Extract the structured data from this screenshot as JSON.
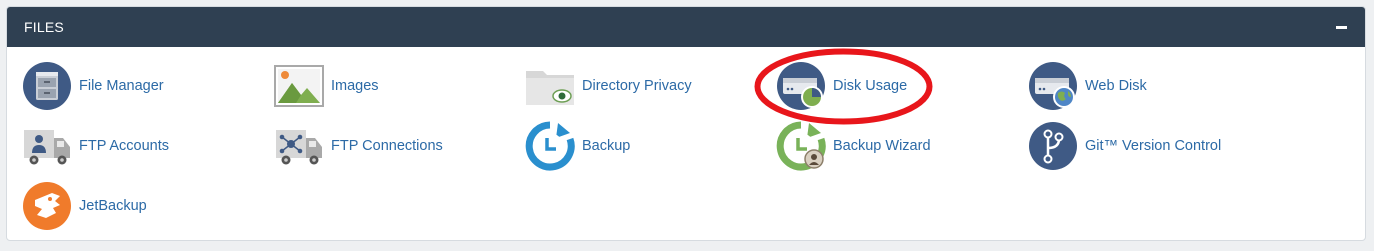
{
  "panel": {
    "title": "FILES",
    "collapse_icon": "minus-icon"
  },
  "items": [
    {
      "label": "File Manager",
      "icon": "file-cabinet-icon"
    },
    {
      "label": "Images",
      "icon": "image-landscape-icon"
    },
    {
      "label": "Directory Privacy",
      "icon": "folder-eye-icon"
    },
    {
      "label": "Disk Usage",
      "icon": "disk-pie-chart-icon"
    },
    {
      "label": "Web Disk",
      "icon": "disk-globe-icon"
    },
    {
      "label": "FTP Accounts",
      "icon": "truck-user-icon"
    },
    {
      "label": "FTP Connections",
      "icon": "truck-network-icon"
    },
    {
      "label": "Backup",
      "icon": "backup-clock-icon"
    },
    {
      "label": "Backup Wizard",
      "icon": "backup-wizard-icon"
    },
    {
      "label": "Git™ Version Control",
      "icon": "git-branch-icon"
    },
    {
      "label": "JetBackup",
      "icon": "jetbackup-logo-icon"
    }
  ],
  "annotation": {
    "highlighted_item": "Disk Usage",
    "color": "#e8161b"
  },
  "colors": {
    "header_bg": "#2f4052",
    "link": "#2c6aa6"
  }
}
